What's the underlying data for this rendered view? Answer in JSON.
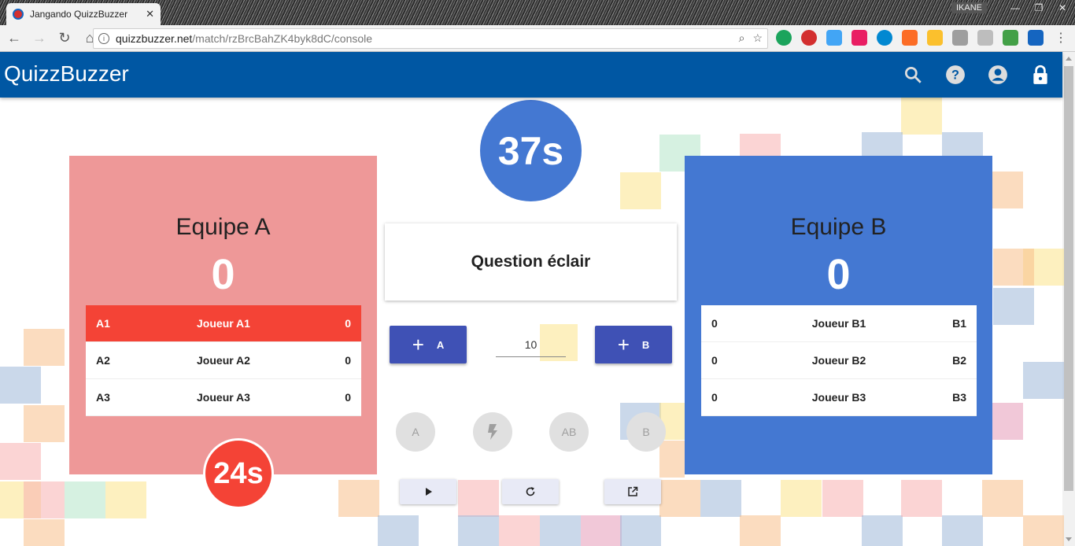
{
  "browser": {
    "tab_title": "Jangando QuizzBuzzer",
    "user": "IKANE",
    "url_host": "quizzbuzzer.net",
    "url_path": "/match/rzBrcBahZK4byk8dC/console"
  },
  "app": {
    "brand": "QuizzBuzzer",
    "bar_color": "#0057a3"
  },
  "timer_top": "37s",
  "timer_team": "24s",
  "question": "Question éclair",
  "points_value": "10",
  "team_a": {
    "name": "Equipe A",
    "score": "0",
    "color": "#ee9898",
    "players": [
      {
        "id": "A1",
        "name": "Joueur A1",
        "score": "0",
        "active": true
      },
      {
        "id": "A2",
        "name": "Joueur A2",
        "score": "0",
        "active": false
      },
      {
        "id": "A3",
        "name": "Joueur A3",
        "score": "0",
        "active": false
      }
    ]
  },
  "team_b": {
    "name": "Equipe B",
    "score": "0",
    "color": "#4478d2",
    "players": [
      {
        "id": "B1",
        "name": "Joueur B1",
        "score": "0"
      },
      {
        "id": "B2",
        "name": "Joueur B2",
        "score": "0"
      },
      {
        "id": "B3",
        "name": "Joueur B3",
        "score": "0"
      }
    ]
  },
  "controls": {
    "add_a_label": "A",
    "add_b_label": "B",
    "buzz_a": "A",
    "buzz_ab": "AB",
    "buzz_b": "B"
  },
  "icons": {
    "search": "search-icon",
    "help": "help-icon",
    "account": "account-icon",
    "lock": "lock-icon",
    "lightning": "lightning-icon",
    "play": "play-icon",
    "refresh": "refresh-icon",
    "open": "open-in-new-icon"
  }
}
